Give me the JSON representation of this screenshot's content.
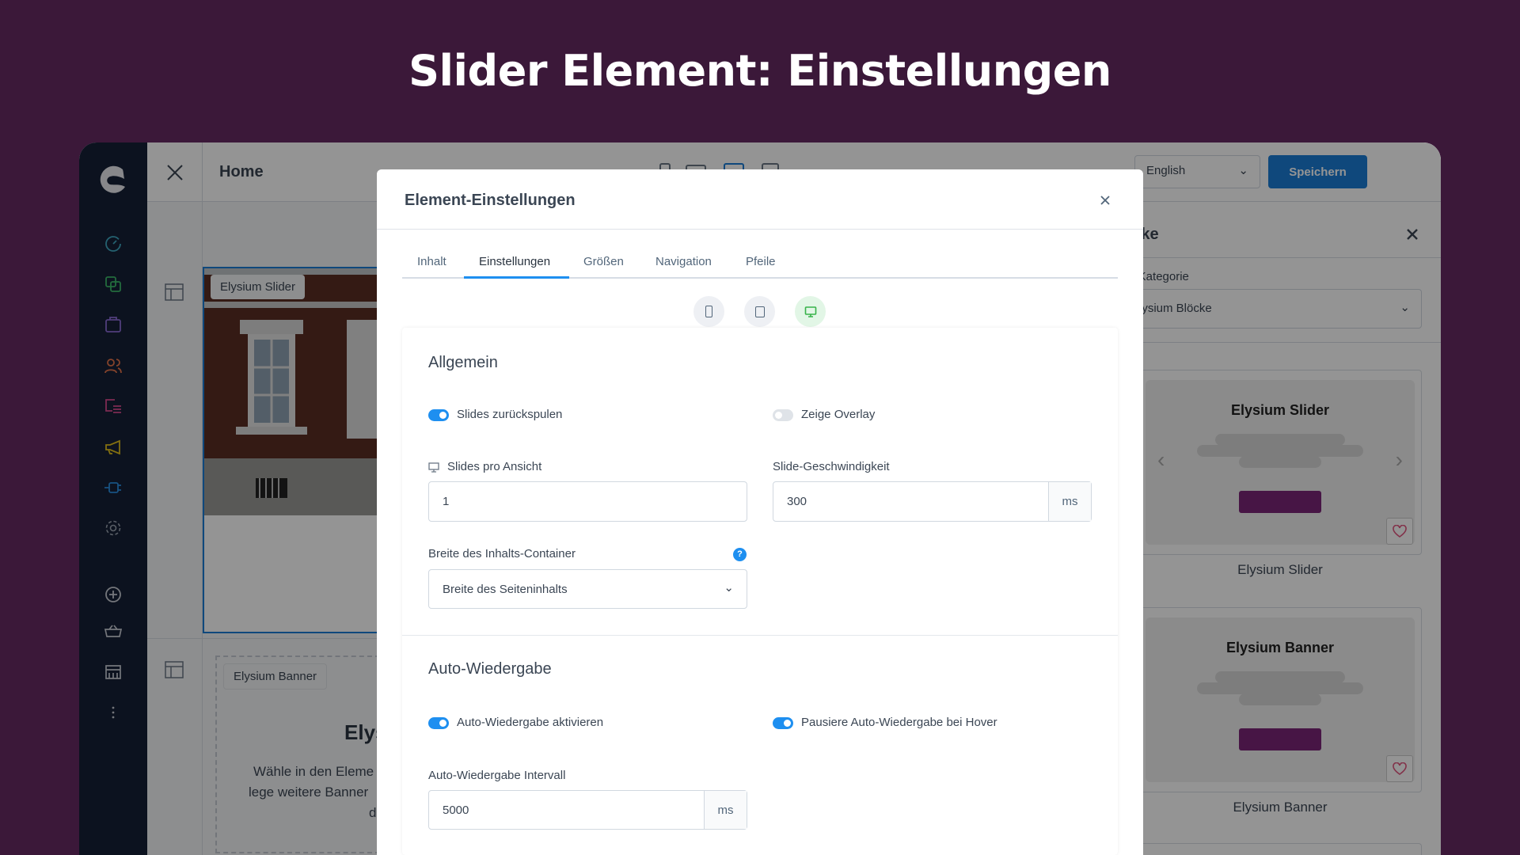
{
  "headline": "Slider Element: Einstellungen",
  "topbar": {
    "page": "Home",
    "language": "English",
    "save": "Speichern"
  },
  "sidebar": {
    "icons": [
      "dashboard-icon",
      "catalogue-icon",
      "orders-icon",
      "customers-icon",
      "content-icon",
      "marketing-icon",
      "extensions-icon",
      "settings-icon",
      "add-icon",
      "basket-icon",
      "storefront-icon",
      "more-icon"
    ]
  },
  "canvas": {
    "slider_label": "Elysium Slider",
    "banner_label": "Elysium Banner",
    "banner_heading": "Elys",
    "banner_text": [
      "Wähle in den Eleme",
      "lege weitere Banner",
      "d"
    ]
  },
  "right_panel": {
    "title": "Blöcke",
    "category_label": "Block-Kategorie",
    "category_value": "Elysium Blöcke",
    "blocks": [
      {
        "preview_title": "Elysium Slider",
        "name": "Elysium Slider"
      },
      {
        "preview_title": "Elysium Banner",
        "name": "Elysium Banner"
      }
    ]
  },
  "modal": {
    "title": "Element-Einstellungen",
    "tabs": [
      "Inhalt",
      "Einstellungen",
      "Größen",
      "Navigation",
      "Pfeile"
    ],
    "active_tab": "Einstellungen",
    "active_device": "desktop",
    "general": {
      "heading": "Allgemein",
      "rewind": {
        "label": "Slides zurückspulen",
        "on": true
      },
      "overlay": {
        "label": "Zeige Overlay",
        "on": false
      },
      "slides_per_view": {
        "label": "Slides pro Ansicht",
        "value": "1"
      },
      "speed": {
        "label": "Slide-Geschwindigkeit",
        "value": "300",
        "unit": "ms"
      },
      "container_width": {
        "label": "Breite des Inhalts-Container",
        "value": "Breite des Seiteninhalts"
      }
    },
    "autoplay": {
      "heading": "Auto-Wiedergabe",
      "enable": {
        "label": "Auto-Wiedergabe aktivieren",
        "on": true
      },
      "pause_hover": {
        "label": "Pausiere Auto-Wiedergabe bei Hover",
        "on": true
      },
      "interval": {
        "label": "Auto-Wiedergabe Intervall",
        "value": "5000",
        "unit": "ms"
      }
    }
  },
  "colors": {
    "background": "#3b1839",
    "accent": "#1e8ff0",
    "sidebar": "#162036",
    "brand_button": "#7a2577"
  }
}
